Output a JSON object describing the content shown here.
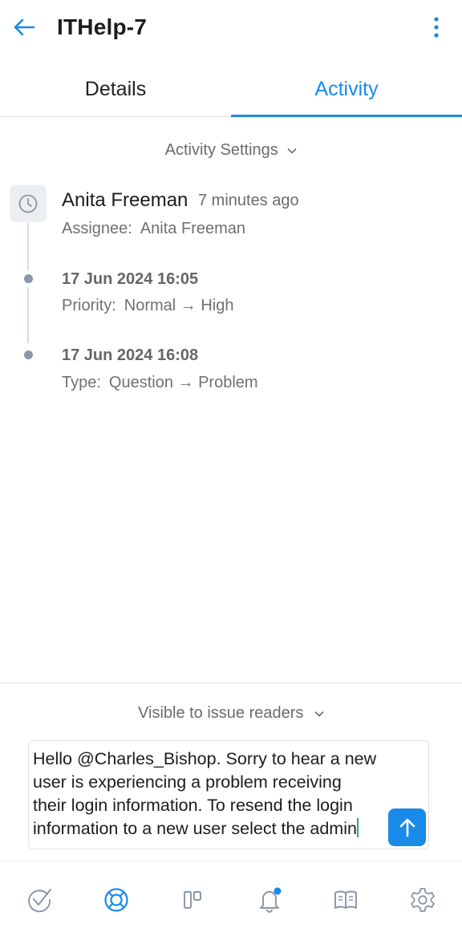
{
  "header": {
    "title": "ITHelp-7",
    "back_icon": "arrow-left-icon",
    "menu_icon": "kebab-menu-icon",
    "accent_color": "#1a8ae8"
  },
  "tabs": [
    {
      "label": "Details",
      "active": false
    },
    {
      "label": "Activity",
      "active": true
    }
  ],
  "activity_settings": {
    "label": "Activity Settings"
  },
  "timeline": {
    "author": "Anita Freeman",
    "time_ago": "7 minutes ago",
    "entries": [
      {
        "field": "Assignee:",
        "value": "Anita Freeman"
      },
      {
        "date": "17 Jun 2024 16:05",
        "field": "Priority:",
        "value": "Normal → High"
      },
      {
        "date": "17 Jun 2024 16:08",
        "field": "Type:",
        "value": "Question → Problem"
      }
    ]
  },
  "composer": {
    "visibility": "Visible to issue readers",
    "text": "Hello @Charles_Bishop. Sorry to hear a new\nuser is experiencing a problem receiving\ntheir login information. To resend the login\ninformation to a new user select the admin",
    "send_icon": "arrow-up-icon"
  },
  "bottom_nav": [
    {
      "icon": "check-circle-icon",
      "active": false
    },
    {
      "icon": "lifebuoy-icon",
      "active": true
    },
    {
      "icon": "board-icon",
      "active": false
    },
    {
      "icon": "bell-icon",
      "active": false,
      "has_badge": true
    },
    {
      "icon": "book-icon",
      "active": false
    },
    {
      "icon": "gear-icon",
      "active": false
    }
  ]
}
